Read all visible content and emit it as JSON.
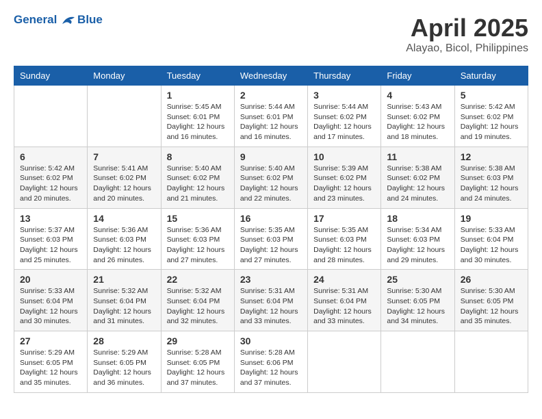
{
  "logo": {
    "line1": "General",
    "line2": "Blue"
  },
  "title": "April 2025",
  "subtitle": "Alayao, Bicol, Philippines",
  "weekdays": [
    "Sunday",
    "Monday",
    "Tuesday",
    "Wednesday",
    "Thursday",
    "Friday",
    "Saturday"
  ],
  "weeks": [
    [
      {
        "day": "",
        "info": ""
      },
      {
        "day": "",
        "info": ""
      },
      {
        "day": "1",
        "info": "Sunrise: 5:45 AM\nSunset: 6:01 PM\nDaylight: 12 hours and 16 minutes."
      },
      {
        "day": "2",
        "info": "Sunrise: 5:44 AM\nSunset: 6:01 PM\nDaylight: 12 hours and 16 minutes."
      },
      {
        "day": "3",
        "info": "Sunrise: 5:44 AM\nSunset: 6:02 PM\nDaylight: 12 hours and 17 minutes."
      },
      {
        "day": "4",
        "info": "Sunrise: 5:43 AM\nSunset: 6:02 PM\nDaylight: 12 hours and 18 minutes."
      },
      {
        "day": "5",
        "info": "Sunrise: 5:42 AM\nSunset: 6:02 PM\nDaylight: 12 hours and 19 minutes."
      }
    ],
    [
      {
        "day": "6",
        "info": "Sunrise: 5:42 AM\nSunset: 6:02 PM\nDaylight: 12 hours and 20 minutes."
      },
      {
        "day": "7",
        "info": "Sunrise: 5:41 AM\nSunset: 6:02 PM\nDaylight: 12 hours and 20 minutes."
      },
      {
        "day": "8",
        "info": "Sunrise: 5:40 AM\nSunset: 6:02 PM\nDaylight: 12 hours and 21 minutes."
      },
      {
        "day": "9",
        "info": "Sunrise: 5:40 AM\nSunset: 6:02 PM\nDaylight: 12 hours and 22 minutes."
      },
      {
        "day": "10",
        "info": "Sunrise: 5:39 AM\nSunset: 6:02 PM\nDaylight: 12 hours and 23 minutes."
      },
      {
        "day": "11",
        "info": "Sunrise: 5:38 AM\nSunset: 6:02 PM\nDaylight: 12 hours and 24 minutes."
      },
      {
        "day": "12",
        "info": "Sunrise: 5:38 AM\nSunset: 6:03 PM\nDaylight: 12 hours and 24 minutes."
      }
    ],
    [
      {
        "day": "13",
        "info": "Sunrise: 5:37 AM\nSunset: 6:03 PM\nDaylight: 12 hours and 25 minutes."
      },
      {
        "day": "14",
        "info": "Sunrise: 5:36 AM\nSunset: 6:03 PM\nDaylight: 12 hours and 26 minutes."
      },
      {
        "day": "15",
        "info": "Sunrise: 5:36 AM\nSunset: 6:03 PM\nDaylight: 12 hours and 27 minutes."
      },
      {
        "day": "16",
        "info": "Sunrise: 5:35 AM\nSunset: 6:03 PM\nDaylight: 12 hours and 27 minutes."
      },
      {
        "day": "17",
        "info": "Sunrise: 5:35 AM\nSunset: 6:03 PM\nDaylight: 12 hours and 28 minutes."
      },
      {
        "day": "18",
        "info": "Sunrise: 5:34 AM\nSunset: 6:03 PM\nDaylight: 12 hours and 29 minutes."
      },
      {
        "day": "19",
        "info": "Sunrise: 5:33 AM\nSunset: 6:04 PM\nDaylight: 12 hours and 30 minutes."
      }
    ],
    [
      {
        "day": "20",
        "info": "Sunrise: 5:33 AM\nSunset: 6:04 PM\nDaylight: 12 hours and 30 minutes."
      },
      {
        "day": "21",
        "info": "Sunrise: 5:32 AM\nSunset: 6:04 PM\nDaylight: 12 hours and 31 minutes."
      },
      {
        "day": "22",
        "info": "Sunrise: 5:32 AM\nSunset: 6:04 PM\nDaylight: 12 hours and 32 minutes."
      },
      {
        "day": "23",
        "info": "Sunrise: 5:31 AM\nSunset: 6:04 PM\nDaylight: 12 hours and 33 minutes."
      },
      {
        "day": "24",
        "info": "Sunrise: 5:31 AM\nSunset: 6:04 PM\nDaylight: 12 hours and 33 minutes."
      },
      {
        "day": "25",
        "info": "Sunrise: 5:30 AM\nSunset: 6:05 PM\nDaylight: 12 hours and 34 minutes."
      },
      {
        "day": "26",
        "info": "Sunrise: 5:30 AM\nSunset: 6:05 PM\nDaylight: 12 hours and 35 minutes."
      }
    ],
    [
      {
        "day": "27",
        "info": "Sunrise: 5:29 AM\nSunset: 6:05 PM\nDaylight: 12 hours and 35 minutes."
      },
      {
        "day": "28",
        "info": "Sunrise: 5:29 AM\nSunset: 6:05 PM\nDaylight: 12 hours and 36 minutes."
      },
      {
        "day": "29",
        "info": "Sunrise: 5:28 AM\nSunset: 6:05 PM\nDaylight: 12 hours and 37 minutes."
      },
      {
        "day": "30",
        "info": "Sunrise: 5:28 AM\nSunset: 6:06 PM\nDaylight: 12 hours and 37 minutes."
      },
      {
        "day": "",
        "info": ""
      },
      {
        "day": "",
        "info": ""
      },
      {
        "day": "",
        "info": ""
      }
    ]
  ]
}
